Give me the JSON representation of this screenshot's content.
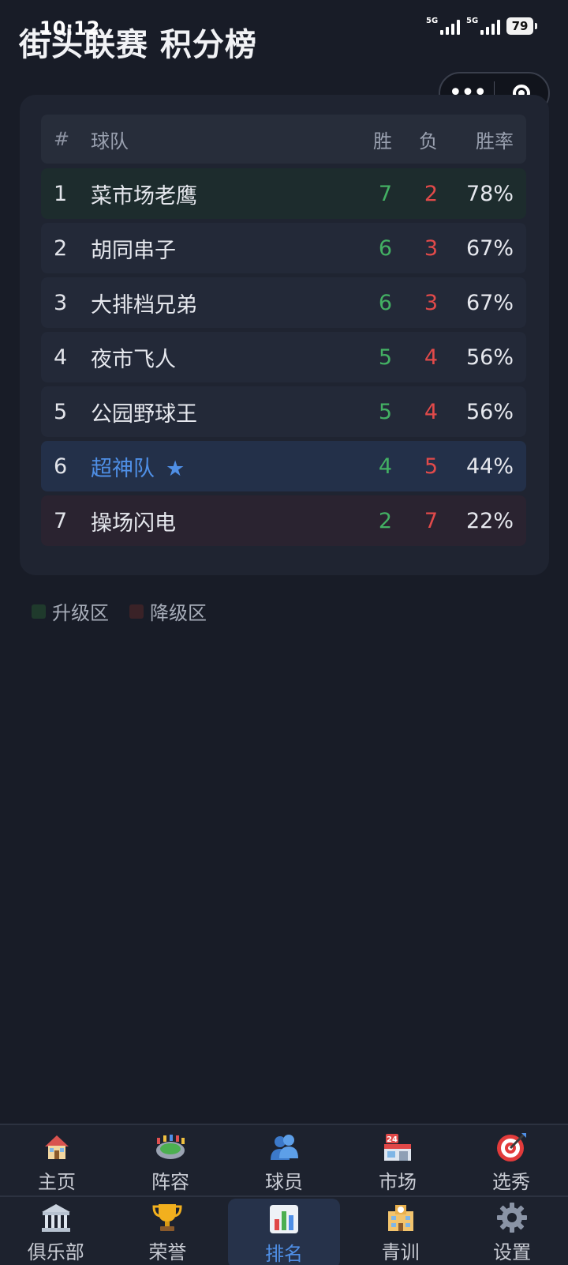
{
  "status_bar": {
    "time": "10:12",
    "network_1": "5G",
    "network_2": "5G",
    "battery": "79"
  },
  "header": {
    "title": "街头联赛 积分榜"
  },
  "table": {
    "headers": {
      "rank": "#",
      "team": "球队",
      "wins": "胜",
      "losses": "负",
      "pct": "胜率"
    },
    "rows": [
      {
        "rank": "1",
        "team": "菜市场老鹰",
        "wins": "7",
        "losses": "2",
        "pct": "78%"
      },
      {
        "rank": "2",
        "team": "胡同串子",
        "wins": "6",
        "losses": "3",
        "pct": "67%"
      },
      {
        "rank": "3",
        "team": "大排档兄弟",
        "wins": "6",
        "losses": "3",
        "pct": "67%"
      },
      {
        "rank": "4",
        "team": "夜市飞人",
        "wins": "5",
        "losses": "4",
        "pct": "56%"
      },
      {
        "rank": "5",
        "team": "公园野球王",
        "wins": "5",
        "losses": "4",
        "pct": "56%"
      },
      {
        "rank": "6",
        "team": "超神队",
        "wins": "4",
        "losses": "5",
        "pct": "44%",
        "star": "★"
      },
      {
        "rank": "7",
        "team": "操场闪电",
        "wins": "2",
        "losses": "7",
        "pct": "22%"
      }
    ]
  },
  "legend": {
    "promotion": "升级区",
    "relegation": "降级区"
  },
  "nav": {
    "row1": [
      {
        "label": "主页",
        "icon": "house-icon"
      },
      {
        "label": "阵容",
        "icon": "stadium-icon"
      },
      {
        "label": "球员",
        "icon": "players-icon"
      },
      {
        "label": "市场",
        "icon": "store-icon"
      },
      {
        "label": "选秀",
        "icon": "target-icon"
      }
    ],
    "row2": [
      {
        "label": "俱乐部",
        "icon": "classical-building-icon"
      },
      {
        "label": "荣誉",
        "icon": "trophy-icon"
      },
      {
        "label": "排名",
        "icon": "bar-chart-icon"
      },
      {
        "label": "青训",
        "icon": "school-icon"
      },
      {
        "label": "设置",
        "icon": "gear-icon"
      }
    ]
  },
  "colors": {
    "background": "#181c27",
    "win": "#43b063",
    "loss": "#e14a4a",
    "highlight": "#4f8fe6",
    "promotion_zone": "#1d2c2d",
    "relegation_zone": "#2a2330"
  }
}
